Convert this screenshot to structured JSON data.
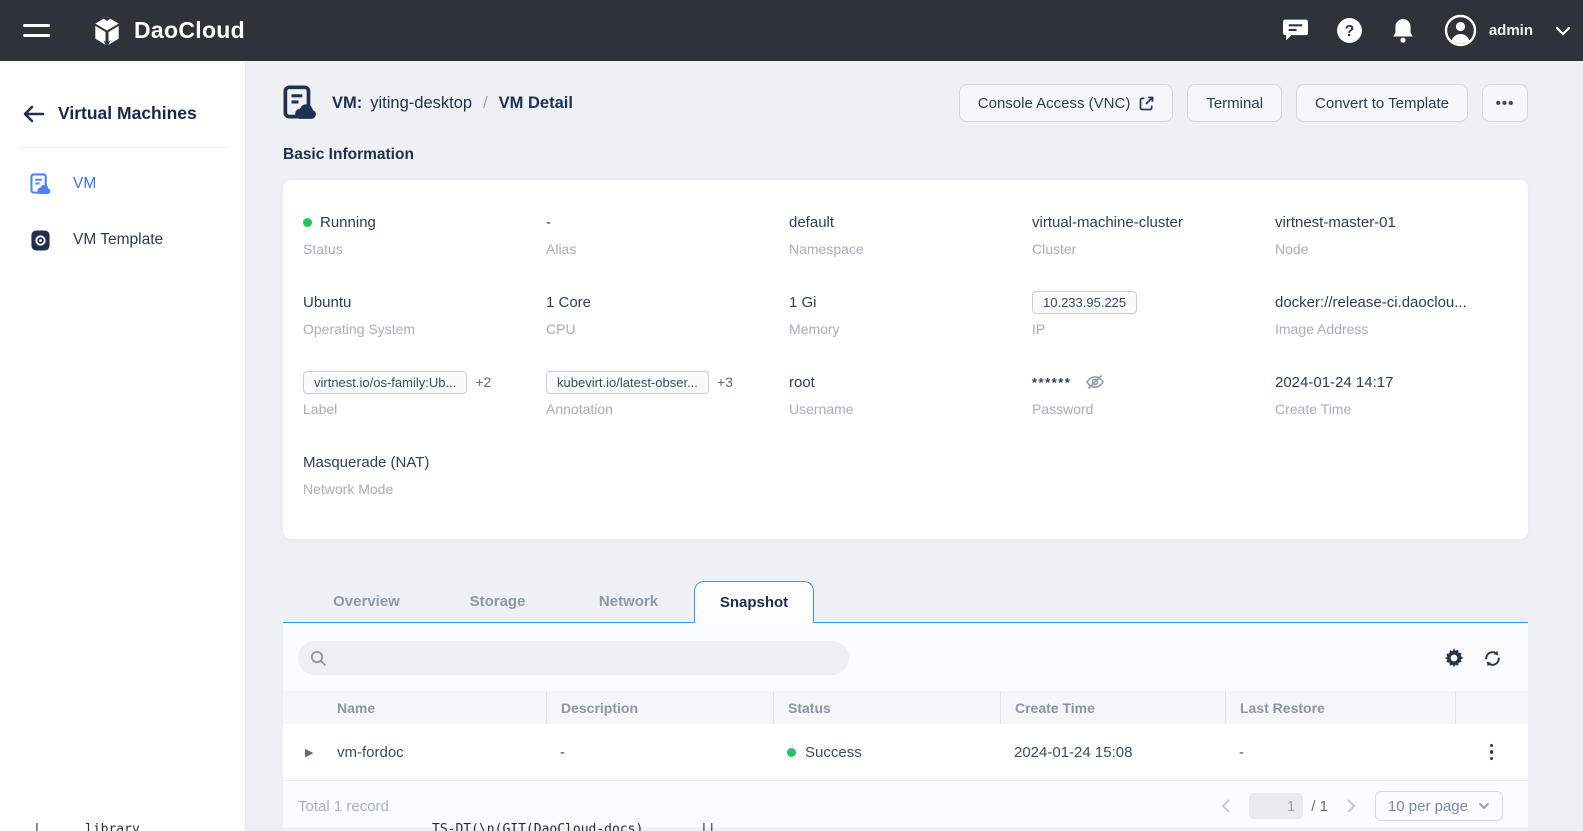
{
  "topbar": {
    "brand": "DaoCloud",
    "user": "admin",
    "help_glyph": "?"
  },
  "sidebar": {
    "title": "Virtual Machines",
    "items": [
      {
        "label": "VM",
        "active": true
      },
      {
        "label": "VM Template",
        "active": false
      }
    ]
  },
  "header": {
    "kind": "VM:",
    "name": "yiting-desktop",
    "sep": "/",
    "page": "VM Detail"
  },
  "actions": {
    "console": "Console Access (VNC)",
    "terminal": "Terminal",
    "convert": "Convert to Template",
    "more": "•••"
  },
  "basic_info": {
    "title": "Basic Information",
    "fields": [
      {
        "value": "Running",
        "label": "Status"
      },
      {
        "value": "-",
        "label": "Alias"
      },
      {
        "value": "default",
        "label": "Namespace"
      },
      {
        "value": "virtual-machine-cluster",
        "label": "Cluster"
      },
      {
        "value": "virtnest-master-01",
        "label": "Node"
      },
      {
        "value": "Ubuntu",
        "label": "Operating System"
      },
      {
        "value": "1 Core",
        "label": "CPU"
      },
      {
        "value": "1 Gi",
        "label": "Memory"
      },
      {
        "value": "10.233.95.225",
        "label": "IP"
      },
      {
        "value": "docker://release-ci.daoclou...",
        "label": "Image Address"
      },
      {
        "value": "virtnest.io/os-family:Ub...",
        "extra": "+2",
        "label": "Label"
      },
      {
        "value": "kubevirt.io/latest-obser...",
        "extra": "+3",
        "label": "Annotation"
      },
      {
        "value": "root",
        "label": "Username"
      },
      {
        "value": "******",
        "label": "Password"
      },
      {
        "value": "2024-01-24 14:17",
        "label": "Create Time"
      },
      {
        "value": "Masquerade (NAT)",
        "label": "Network Mode"
      }
    ]
  },
  "tabs": [
    {
      "label": "Overview"
    },
    {
      "label": "Storage"
    },
    {
      "label": "Network"
    },
    {
      "label": "Snapshot",
      "active": true
    }
  ],
  "snapshot": {
    "search_placeholder": "",
    "table": {
      "columns": [
        "Name",
        "Description",
        "Status",
        "Create Time",
        "Last Restore"
      ],
      "rows": [
        {
          "name": "vm-fordoc",
          "description": "-",
          "status": "Success",
          "create_time": "2024-01-24 15:08",
          "last_restore": "-"
        }
      ]
    },
    "footer": {
      "total": "Total 1 record",
      "page": "1",
      "page_of": "/ 1",
      "page_size": "10 per page"
    }
  },
  "glyphs": {
    "expander": "▶"
  },
  "colors": {
    "topbar_bg": "#2e333a",
    "accent_tab_blue": "#2b9fe3",
    "link_blue": "#4570f2",
    "status_green": "#22c55e",
    "text_dark": "#2c3e58",
    "label_gray": "#a6aeb9"
  },
  "artifacts": {
    "frag1": "|",
    "frag2": "library",
    "frag3": "TS-DT(\\n(GIT(DaoCloud-docs)",
    "frag4": "||"
  }
}
